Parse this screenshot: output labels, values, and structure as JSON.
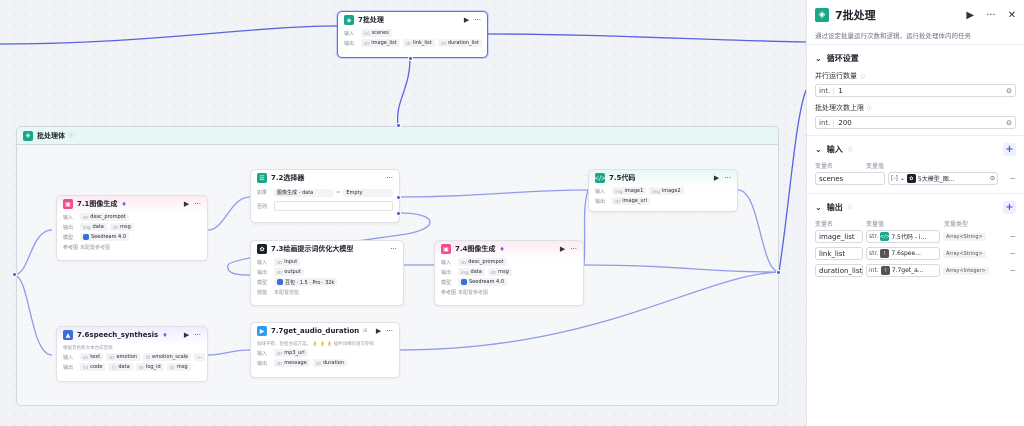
{
  "canvas": {
    "top_node": {
      "title": "7批处理",
      "input_label": "输入",
      "output_label": "输出",
      "inputs": [
        {
          "type": "[o]",
          "name": "scenes"
        }
      ],
      "outputs": [
        {
          "type": "str",
          "name": "image_list"
        },
        {
          "type": "str",
          "name": "link_list"
        },
        {
          "type": "int",
          "name": "duration_list"
        }
      ]
    },
    "loop_body": {
      "title": "批处理体"
    },
    "nodes": {
      "n71": {
        "title": "7.1图像生成",
        "rows": [
          {
            "label": "输入",
            "chips": [
              {
                "type": "str",
                "name": "desc_prompot"
              }
            ]
          },
          {
            "label": "输出",
            "chips": [
              {
                "type": "img",
                "name": "data"
              },
              {
                "type": "str",
                "name": "msg"
              }
            ]
          },
          {
            "label": "模型",
            "chips": [
              {
                "type": "",
                "name": "Seedream 4.0"
              }
            ]
          },
          {
            "label": "参考图",
            "text": "未配置参考图"
          }
        ]
      },
      "n72": {
        "title": "7.2选择器",
        "if_label": "如果",
        "cond_left": "图像生成 - data",
        "cond_op": "=",
        "cond_right": "Empty",
        "else_label": "否则"
      },
      "n73": {
        "title": "7.3绘画提示词优化大模型",
        "rows": [
          {
            "label": "输入",
            "chips": [
              {
                "type": "str",
                "name": "input"
              }
            ]
          },
          {
            "label": "输出",
            "chips": [
              {
                "type": "str",
                "name": "output"
              }
            ]
          },
          {
            "label": "模型",
            "chips": [
              {
                "type": "",
                "name": "豆包 · 1.5 · Pro · 32k"
              }
            ]
          },
          {
            "label": "技能",
            "text": "未配置技能"
          }
        ]
      },
      "n74": {
        "title": "7.4图像生成",
        "rows": [
          {
            "label": "输入",
            "chips": [
              {
                "type": "str",
                "name": "desc_prompot"
              }
            ]
          },
          {
            "label": "输出",
            "chips": [
              {
                "type": "img",
                "name": "data"
              },
              {
                "type": "str",
                "name": "msg"
              }
            ]
          },
          {
            "label": "模型",
            "chips": [
              {
                "type": "",
                "name": "Seedream 4.0"
              }
            ]
          },
          {
            "label": "参考图",
            "text": "未配置参考图"
          }
        ]
      },
      "n75": {
        "title": "7.5代码",
        "rows": [
          {
            "label": "输入",
            "chips": [
              {
                "type": "img",
                "name": "image1"
              },
              {
                "type": "img",
                "name": "image2"
              }
            ]
          },
          {
            "label": "输出",
            "chips": [
              {
                "type": "str",
                "name": "image_url"
              }
            ]
          }
        ]
      },
      "n76": {
        "title": "7.6speech_synthesis",
        "desc": "根据音色和文本合成音频",
        "rows": [
          {
            "label": "输入",
            "chips": [
              {
                "type": "str",
                "name": "text"
              },
              {
                "type": "str",
                "name": "emotion"
              },
              {
                "type": "flt",
                "name": "emotion_scale"
              },
              {
                "type": "",
                "name": "..."
              }
            ]
          },
          {
            "label": "输出",
            "chips": [
              {
                "type": "int",
                "name": "code"
              },
              {
                "type": "{}",
                "name": "data"
              },
              {
                "type": "str",
                "name": "log_id"
              },
              {
                "type": "str",
                "name": "msg"
              }
            ]
          }
        ]
      },
      "n77": {
        "title": "7.7get_audio_duration",
        "desc": "加味平稳、轻担合成方案。 👌 👌 👌 插件详细页值可参照",
        "rows": [
          {
            "label": "输入",
            "chips": [
              {
                "type": "str",
                "name": "mp3_url"
              }
            ]
          },
          {
            "label": "输出",
            "chips": [
              {
                "type": "str",
                "name": "message"
              },
              {
                "type": "int",
                "name": "duration"
              }
            ]
          }
        ]
      }
    }
  },
  "panel": {
    "title": "7批处理",
    "description": "通过设定批量运行次数和逻辑，运行批处理体内的任务",
    "loop_section": {
      "title": "循环设置",
      "parallel_label": "并行运行数量",
      "parallel_type": "int.",
      "parallel_value": "1",
      "max_label": "批处理次数上限",
      "max_type": "int.",
      "max_value": "200"
    },
    "input_section": {
      "title": "输入",
      "col_name": "变量名",
      "col_value": "变量值",
      "rows": [
        {
          "name": "scenes",
          "type": "[-]",
          "value": "5大模型_图..."
        }
      ]
    },
    "output_section": {
      "title": "输出",
      "col_name": "变量名",
      "col_value": "变量值",
      "col_type": "变量类型",
      "rows": [
        {
          "name": "image_list",
          "type": "str.",
          "value": "7.5代码 - i...",
          "vartype": "Array<String>"
        },
        {
          "name": "link_list",
          "type": "str.",
          "value": "7.6spee...",
          "vartype": "Array<String>"
        },
        {
          "name": "duration_list",
          "type": "int.",
          "value": "7.7get_a...",
          "vartype": "Array<Integer>"
        }
      ]
    }
  },
  "colors": {
    "accent": "#4d5bd8",
    "loop_icon": "#1aa689",
    "image_icon": "#f04d8b",
    "code_icon": "#1aa689",
    "selector_icon": "#1aa689",
    "llm_icon": "#1d2129",
    "speech_icon": "#3b6ed6",
    "audio_icon": "#2f9cf0"
  }
}
